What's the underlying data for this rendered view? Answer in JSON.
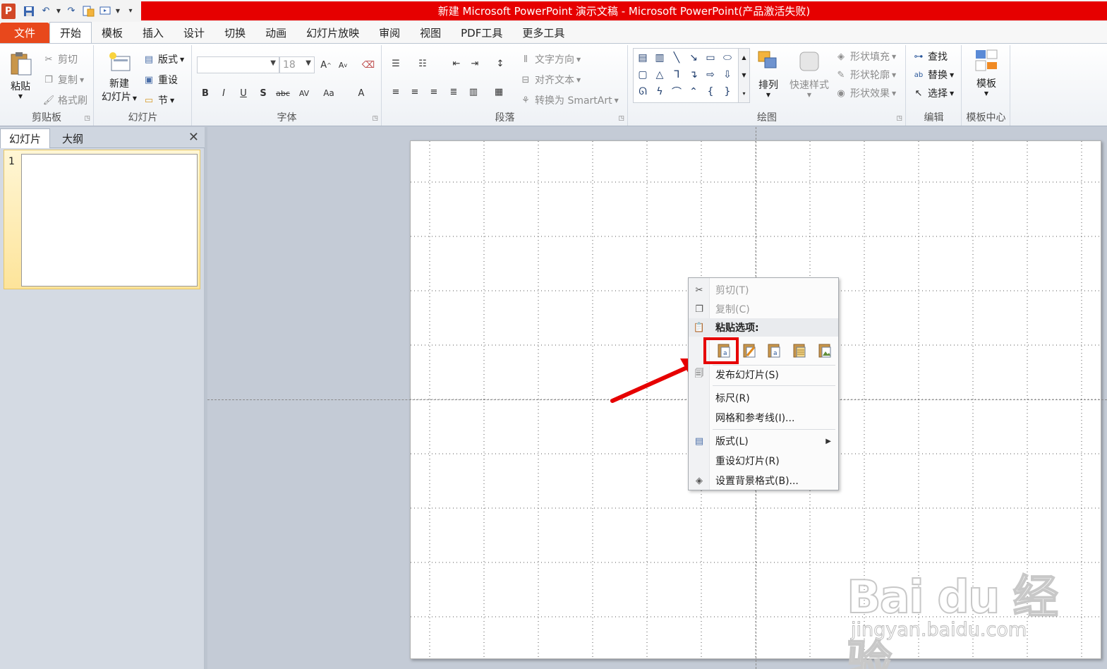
{
  "window": {
    "title": "新建 Microsoft PowerPoint 演示文稿 - Microsoft PowerPoint(产品激活失败)",
    "app_logo": "P"
  },
  "tabs": [
    {
      "label": "文件"
    },
    {
      "label": "开始"
    },
    {
      "label": "模板"
    },
    {
      "label": "插入"
    },
    {
      "label": "设计"
    },
    {
      "label": "切换"
    },
    {
      "label": "动画"
    },
    {
      "label": "幻灯片放映"
    },
    {
      "label": "审阅"
    },
    {
      "label": "视图"
    },
    {
      "label": "PDF工具"
    },
    {
      "label": "更多工具"
    }
  ],
  "ribbon": {
    "clipboard": {
      "label": "剪贴板",
      "paste": "粘贴",
      "cut": "剪切",
      "copy": "复制",
      "format_painter": "格式刷"
    },
    "slides": {
      "label": "幻灯片",
      "new_slide_line1": "新建",
      "new_slide_line2": "幻灯片",
      "layout": "版式",
      "reset": "重设",
      "section": "节"
    },
    "font": {
      "label": "字体",
      "font_name": "",
      "font_size": "18"
    },
    "paragraph": {
      "label": "段落",
      "text_direction": "文字方向",
      "align_text": "对齐文本",
      "smartart": "转换为 SmartArt"
    },
    "drawing": {
      "label": "绘图",
      "arrange": "排列",
      "quick_styles": "快速样式",
      "shape_fill": "形状填充",
      "shape_outline": "形状轮廓",
      "shape_effects": "形状效果"
    },
    "editing": {
      "label": "编辑",
      "find": "查找",
      "replace": "替换",
      "select": "选择"
    },
    "template": {
      "label": "模板中心",
      "button": "模板"
    }
  },
  "left_pane": {
    "tab_slides": "幻灯片",
    "tab_outline": "大纲",
    "slide_number": "1"
  },
  "context_menu": {
    "cut": "剪切(T)",
    "copy": "复制(C)",
    "paste_options": "粘贴选项:",
    "publish_slides": "发布幻灯片(S)",
    "ruler": "标尺(R)",
    "grid_guides": "网格和参考线(I)...",
    "layout": "版式(L)",
    "reset_slide": "重设幻灯片(R)",
    "format_background": "设置背景格式(B)..."
  },
  "watermark": {
    "logo": "Bai du 经验",
    "url": "jingyan.baidu.com"
  },
  "colors": {
    "title_red": "#e60000",
    "file_tab": "#e8481c",
    "highlight": "#e60000"
  }
}
